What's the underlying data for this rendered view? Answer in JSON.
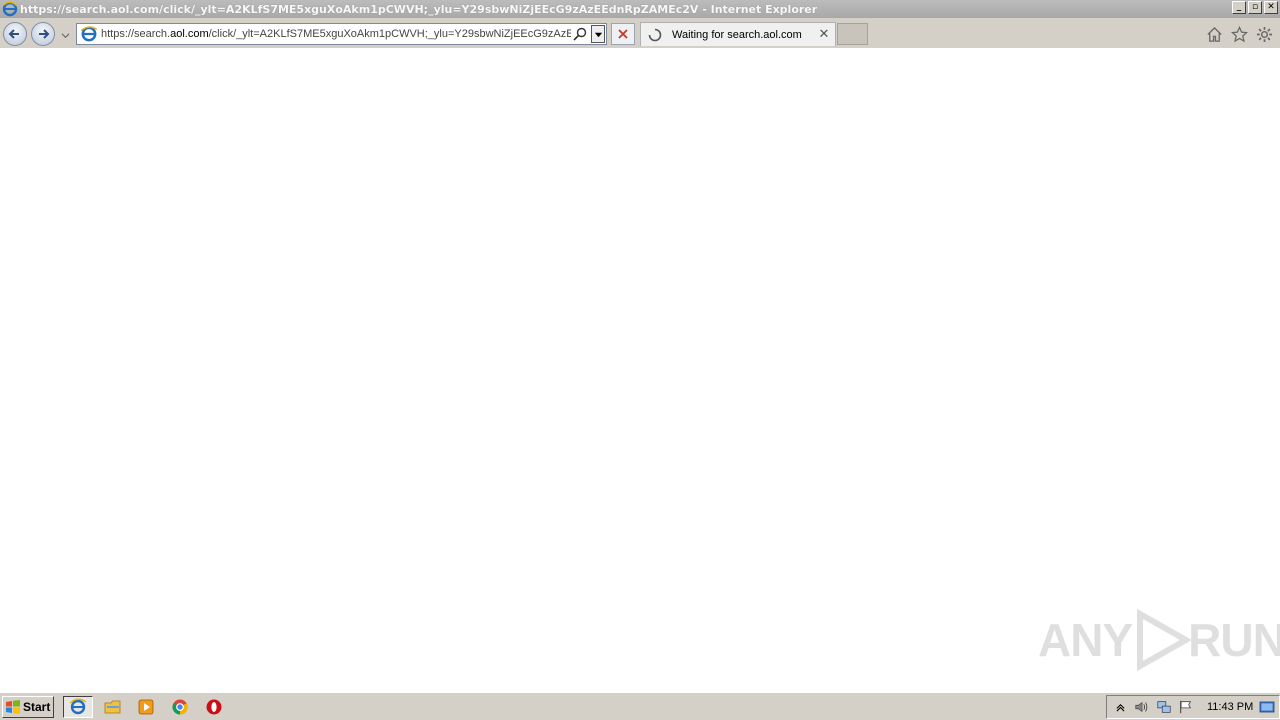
{
  "window": {
    "title": "https://search.aol.com/click/_ylt=A2KLfS7ME5xguXoAkm1pCWVH;_ylu=Y29sbwNiZjEEcG9zAzEEdnRpZAMEc2V - Internet Explorer"
  },
  "navigation": {
    "address_prefix": "https://search.",
    "address_domain": "aol.com",
    "address_suffix": "/click/_ylt=A2KLfS7ME5xguXoAkm1pCWVH;_ylu=Y29sbwNiZjEEcG9zAzEEdr"
  },
  "tab": {
    "label": "Waiting for search.aol.com"
  },
  "watermark": {
    "text_left": "ANY",
    "text_right": "RUN"
  },
  "taskbar": {
    "start_label": "Start",
    "clock": "11:43 PM"
  },
  "colors": {
    "accent_ie_blue": "#1e6fc8",
    "stop_red": "#c0392b",
    "taskbar_gray": "#d4d0c8"
  }
}
